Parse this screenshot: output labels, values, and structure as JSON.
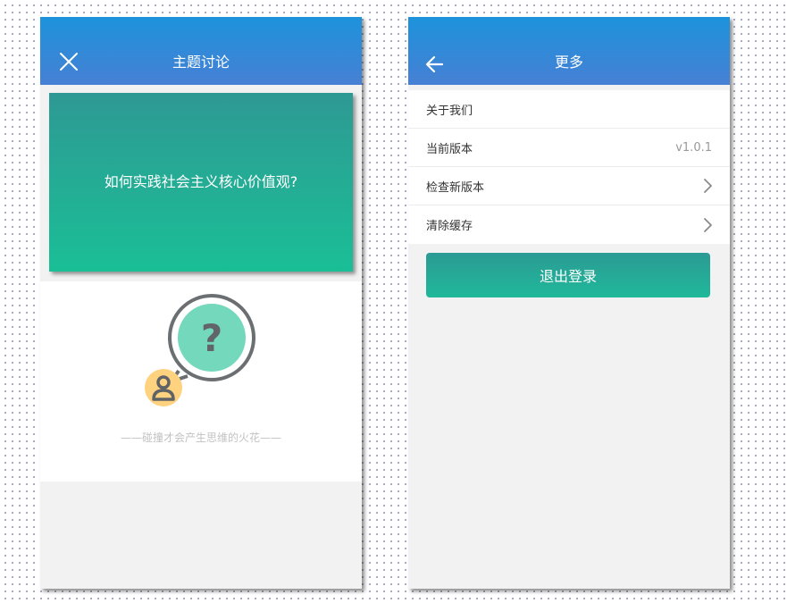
{
  "discussion_screen": {
    "title": "主题讨论",
    "close_icon": "close-icon",
    "topic_question": "如何实践社会主义核心价值观?",
    "illustration_glyph": "?",
    "tagline": "——碰撞才会产生思维的火花——"
  },
  "more_screen": {
    "title": "更多",
    "back_icon": "arrow-left-icon",
    "items": [
      {
        "label": "关于我们",
        "value": "",
        "chevron": false
      },
      {
        "label": "当前版本",
        "value": "v1.0.1",
        "chevron": false
      },
      {
        "label": "检查新版本",
        "value": "",
        "chevron": true
      },
      {
        "label": "清除缓存",
        "value": "",
        "chevron": true
      }
    ],
    "logout_label": "退出登录"
  },
  "colors": {
    "header_top": "#1d93dc",
    "header_bottom": "#4780d4",
    "accent_teal": "#1abf96",
    "bubble_fill": "#74d9bc",
    "avatar_fill": "#ffd27f"
  }
}
